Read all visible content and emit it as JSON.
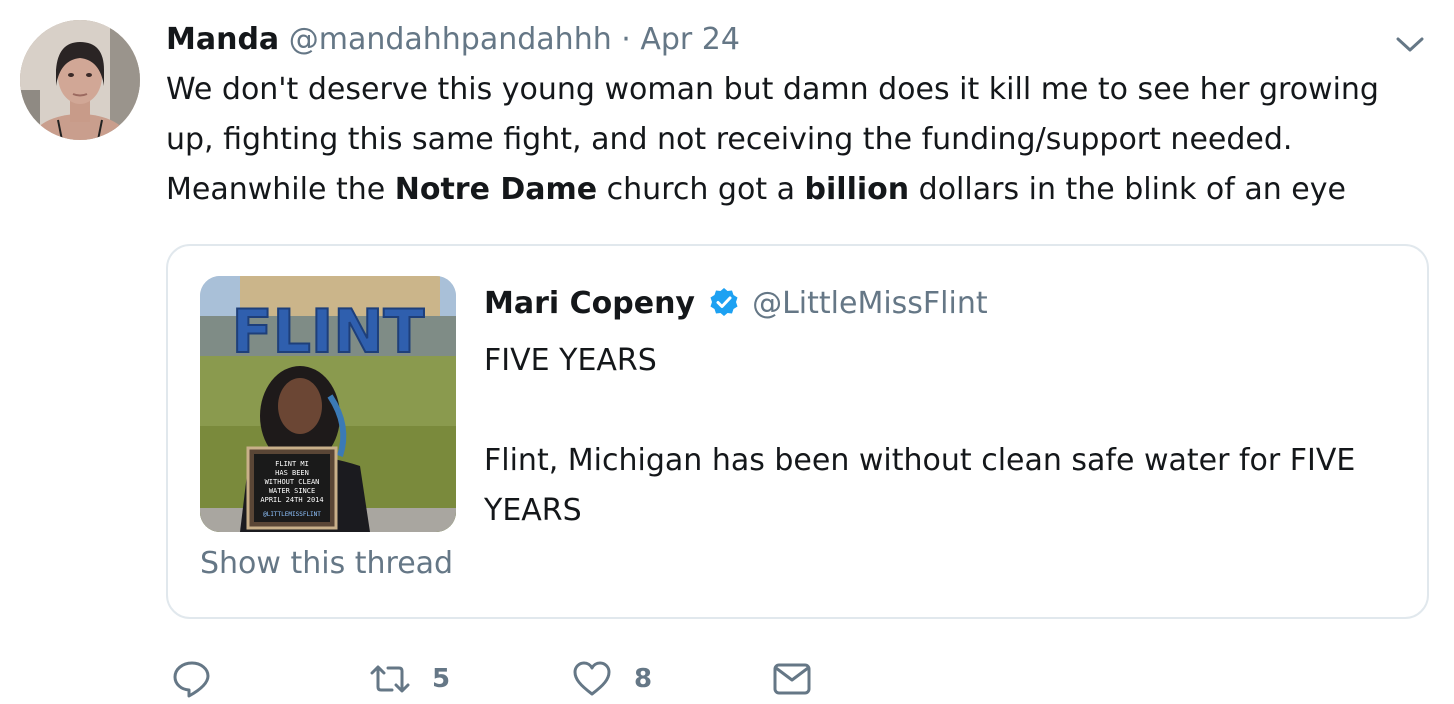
{
  "author": {
    "name": "Manda",
    "handle": "@mandahhpandahhh",
    "separator": "·",
    "date": "Apr 24"
  },
  "tweet": {
    "segments": [
      {
        "text": "We don't deserve this young woman but damn does it kill me to see her growing up, fighting this same fight, and not receiving the funding/support needed. Meanwhile the ",
        "bold": false
      },
      {
        "text": "Notre Dame",
        "bold": true
      },
      {
        "text": " church got a ",
        "bold": false
      },
      {
        "text": "billion",
        "bold": true
      },
      {
        "text": " dollars in the blink of an eye",
        "bold": false
      }
    ]
  },
  "quote": {
    "name": "Mari Copeny",
    "handle": "@LittleMissFlint",
    "verified": true,
    "lines": [
      "FIVE YEARS",
      "Flint, Michigan has been without clean safe water for FIVE YEARS"
    ],
    "show_thread": "Show this thread",
    "image": {
      "sign_text": "FLINT",
      "board_lines": [
        "FLINT MI",
        "HAS BEEN",
        "WITHOUT CLEAN",
        "WATER SINCE",
        "APRIL 24TH 2014",
        "@LITTLEMISSFLINT"
      ]
    }
  },
  "actions": {
    "reply": {
      "icon": "reply-icon",
      "count": ""
    },
    "retweet": {
      "icon": "retweet-icon",
      "count": "5"
    },
    "like": {
      "icon": "heart-icon",
      "count": "8"
    },
    "dm": {
      "icon": "envelope-icon",
      "count": ""
    }
  },
  "colors": {
    "text": "#14171a",
    "secondary": "#657786",
    "border": "#e1e8ed",
    "verified": "#1da1f2"
  }
}
